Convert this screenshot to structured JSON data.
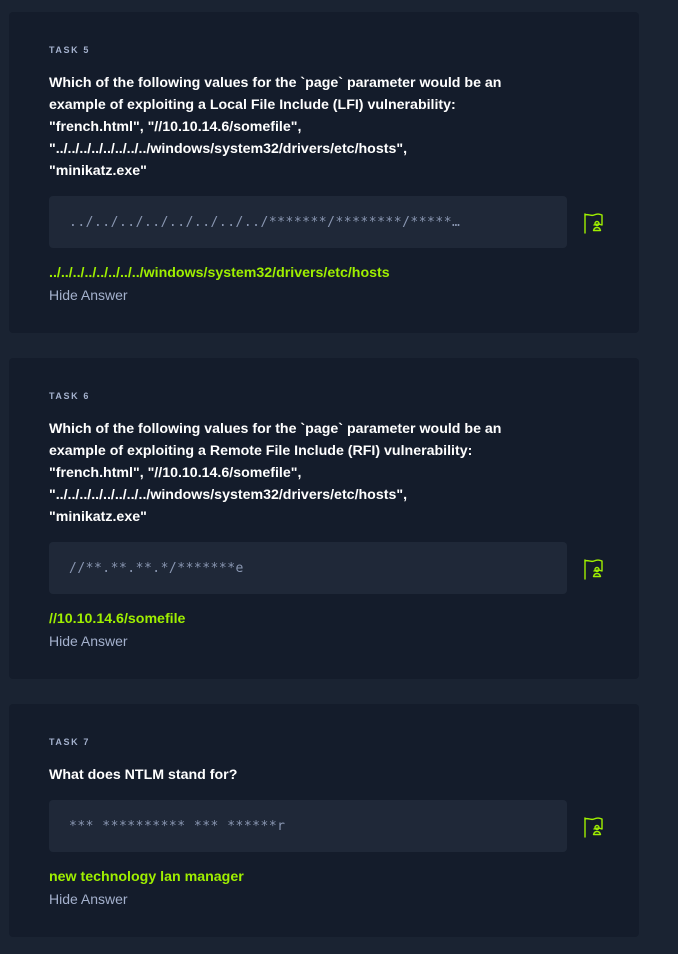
{
  "tasks": [
    {
      "label": "TASK 5",
      "question": "Which of the following values for the `page` parameter would be an example of exploiting a Local File Include (LFI) vulnerability:\n\"french.html\", \"//10.10.14.6/somefile\",\n\"../../../../../../../../windows/system32/drivers/etc/hosts\",\n\"minikatz.exe\"",
      "masked_answer": "../../../../../../../../*******/********/*****…",
      "answer": "../../../../../../../../windows/system32/drivers/etc/hosts",
      "hide_label": "Hide Answer",
      "flag_icon": "flag-submit-icon"
    },
    {
      "label": "TASK 6",
      "question": "Which of the following values for the `page` parameter would be an example of exploiting a Remote File Include (RFI) vulnerability:\n\"french.html\", \"//10.10.14.6/somefile\",\n\"../../../../../../../../windows/system32/drivers/etc/hosts\",\n\"minikatz.exe\"",
      "masked_answer": "//**.**.**.*/*******e",
      "answer": "//10.10.14.6/somefile",
      "hide_label": "Hide Answer",
      "flag_icon": "flag-submit-icon"
    },
    {
      "label": "TASK 7",
      "question": "What does NTLM stand for?",
      "masked_answer": "*** ********** *** ******r",
      "answer": "new technology lan manager",
      "hide_label": "Hide Answer",
      "flag_icon": "flag-submit-icon"
    }
  ],
  "colors": {
    "page_bg": "#1a2332",
    "card_bg": "#141c2b",
    "answer_box_bg": "#1f2838",
    "accent_green": "#9fef00",
    "muted_text": "#a4b1cd",
    "heading_text": "#ffffff"
  }
}
